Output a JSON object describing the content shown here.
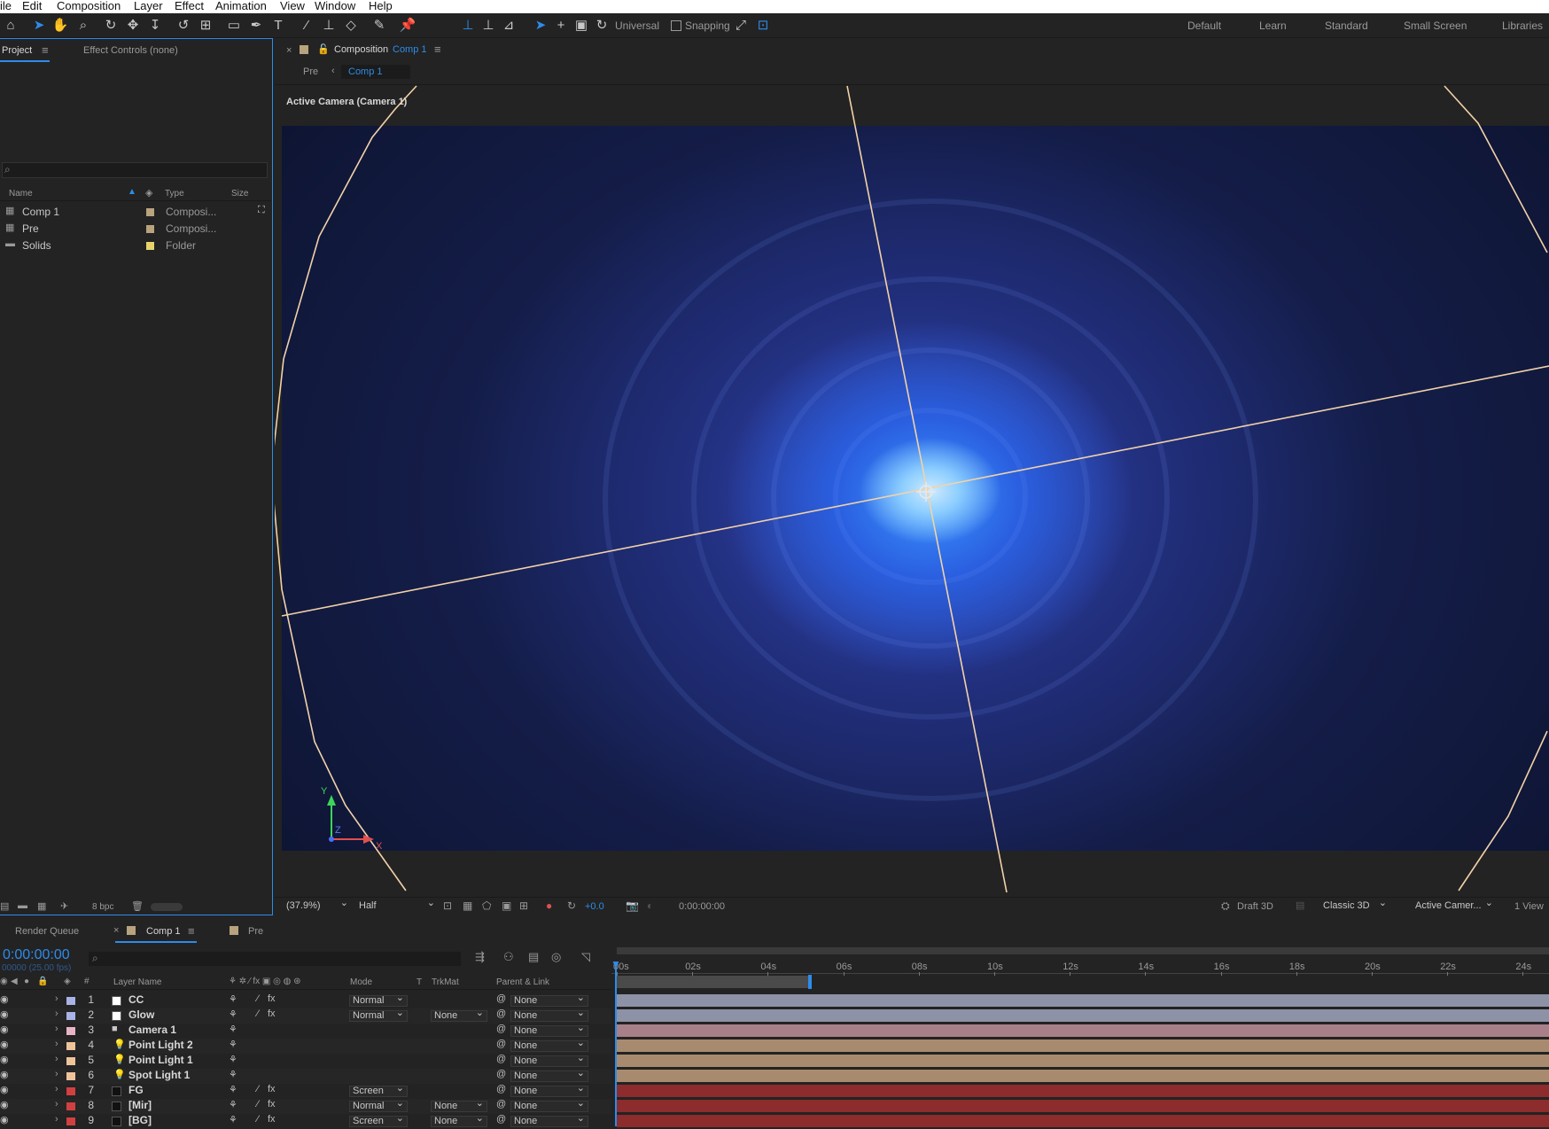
{
  "menu": [
    "ile",
    "Edit",
    "Composition",
    "Layer",
    "Effect",
    "Animation",
    "View",
    "Window",
    "Help"
  ],
  "toolbar": {
    "axis_mode": "Universal",
    "snapping": "Snapping"
  },
  "workspaces": [
    "Default",
    "Learn",
    "Standard",
    "Small Screen",
    "Libraries"
  ],
  "project": {
    "tab": "Project",
    "effect_controls": "Effect Controls (none)",
    "col_name": "Name",
    "col_type": "Type",
    "col_size": "Size",
    "bpc": "8 bpc",
    "items": [
      {
        "name": "Comp 1",
        "type": "Composi...",
        "color": "#b9a27e"
      },
      {
        "name": "Pre",
        "type": "Composi...",
        "color": "#b9a27e"
      },
      {
        "name": "Solids",
        "type": "Folder",
        "color": "#e6d36b"
      }
    ]
  },
  "comp": {
    "title": "Composition",
    "name": "Comp 1",
    "breadcrumb_pre": "Pre",
    "breadcrumb_comp": "Comp 1",
    "camera_label": "Active Camera (Camera 1)",
    "zoom": "(37.9%)",
    "resolution": "Half",
    "exposure": "+0.0",
    "timecode": "0:00:00:00",
    "draft3d": "Draft 3D",
    "renderer": "Classic 3D",
    "view": "Active Camer...",
    "views": "1 View"
  },
  "axis": {
    "y": "Y",
    "z": "Z",
    "x": "X"
  },
  "timeline": {
    "render_queue": "Render Queue",
    "comp_tab": "Comp 1",
    "pre_tab": "Pre",
    "timecode": "0:00:00:00",
    "fps": "00000 (25.00 fps)",
    "col_layer": "Layer Name",
    "col_mode": "Mode",
    "col_t": "T",
    "col_trkmat": "TrkMat",
    "col_parent": "Parent & Link",
    "ruler": [
      "00s",
      "02s",
      "04s",
      "06s",
      "08s",
      "10s",
      "12s",
      "14s",
      "16s",
      "18s",
      "20s",
      "22s",
      "24s"
    ],
    "layers": [
      {
        "num": "1",
        "name": "CC",
        "label": "#a9b3e6",
        "mode": "Normal",
        "trkmat": "",
        "parent": "None",
        "fx": true,
        "bar": "#8d92a6"
      },
      {
        "num": "2",
        "name": "Glow",
        "label": "#a9b3e6",
        "mode": "Normal",
        "trkmat": "None",
        "parent": "None",
        "fx": true,
        "bar": "#8d92a6"
      },
      {
        "num": "3",
        "name": "Camera 1",
        "label": "#e8b5c8",
        "mode": "",
        "trkmat": "",
        "parent": "None",
        "fx": false,
        "bar": "#a8808a"
      },
      {
        "num": "4",
        "name": "Point Light 2",
        "label": "#efc49a",
        "mode": "",
        "trkmat": "",
        "parent": "None",
        "fx": false,
        "bar": "#a88b6e"
      },
      {
        "num": "5",
        "name": "Point Light 1",
        "label": "#efc49a",
        "mode": "",
        "trkmat": "",
        "parent": "None",
        "fx": false,
        "bar": "#a88b6e"
      },
      {
        "num": "6",
        "name": "Spot Light 1",
        "label": "#efc49a",
        "mode": "",
        "trkmat": "",
        "parent": "None",
        "fx": false,
        "bar": "#a88b6e"
      },
      {
        "num": "7",
        "name": "FG",
        "label": "#d04040",
        "mode": "Screen",
        "trkmat": "",
        "parent": "None",
        "fx": true,
        "bar": "#8c2c2c"
      },
      {
        "num": "8",
        "name": "[Mir]",
        "label": "#d04040",
        "mode": "Normal",
        "trkmat": "None",
        "parent": "None",
        "fx": true,
        "bar": "#8c2c2c"
      },
      {
        "num": "9",
        "name": "[BG]",
        "label": "#d04040",
        "mode": "Screen",
        "trkmat": "None",
        "parent": "None",
        "fx": true,
        "bar": "#8c2c2c"
      }
    ]
  },
  "colors": {
    "accent": "#2d8ceb",
    "camera_wire": "#f2d2a8"
  }
}
